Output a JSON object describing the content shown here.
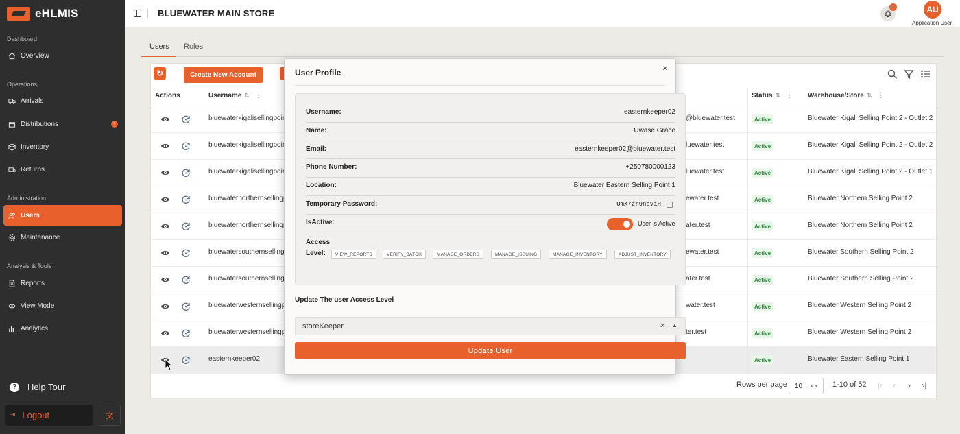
{
  "app": {
    "name": "eHLMIS"
  },
  "sidebar": {
    "sections": {
      "dashboard": "Dashboard",
      "operations": "Operations",
      "administration": "Administration",
      "analysis": "Analysis & Tools"
    },
    "items": [
      {
        "label": "Overview",
        "icon": "home-icon"
      },
      {
        "label": "Arrivals",
        "icon": "truck-icon"
      },
      {
        "label": "Distributions",
        "icon": "box-icon",
        "badge": "1"
      },
      {
        "label": "Inventory",
        "icon": "cube-icon"
      },
      {
        "label": "Returns",
        "icon": "return-icon"
      },
      {
        "label": "Users",
        "icon": "users-icon",
        "active": true
      },
      {
        "label": "Maintenance",
        "icon": "gear-icon"
      },
      {
        "label": "Reports",
        "icon": "file-icon"
      },
      {
        "label": "View Mode",
        "icon": "eye-icon"
      },
      {
        "label": "Analytics",
        "icon": "bar-chart-icon"
      }
    ],
    "help_tour": "Help Tour",
    "logout": "Logout"
  },
  "header": {
    "store_title": "BLUEWATER MAIN STORE",
    "notification_count": "1",
    "avatar_initials": "AU",
    "user_name": "Application User"
  },
  "tabs": [
    {
      "label": "Users",
      "active": true
    },
    {
      "label": "Roles",
      "active": false
    }
  ],
  "toolbar": {
    "create_label": "Create New Account"
  },
  "table": {
    "headers": {
      "actions": "Actions",
      "username": "Username",
      "status": "Status",
      "warehouse": "Warehouse/Store"
    },
    "rows": [
      {
        "username": "bluewaterkigalisellingpoint",
        "email": "@bluewater.test",
        "status": "Active",
        "warehouse": "Bluewater Kigali Selling Point 2 - Outlet 2"
      },
      {
        "username": "bluewaterkigalisellingpoint",
        "email": "luewater.test",
        "status": "Active",
        "warehouse": "Bluewater Kigali Selling Point 2 - Outlet 2"
      },
      {
        "username": "bluewaterkigalisellingpoint",
        "email": "luewater.test",
        "status": "Active",
        "warehouse": "Bluewater Kigali Selling Point 2 - Outlet 1"
      },
      {
        "username": "bluewaternorthernsellingp",
        "email": "ewater.test",
        "status": "Active",
        "warehouse": "Bluewater Northern Selling Point 2"
      },
      {
        "username": "bluewaternorthernsellingp",
        "email": "ater.test",
        "status": "Active",
        "warehouse": "Bluewater Northern Selling Point 2"
      },
      {
        "username": "bluewatersouthernsellingp",
        "email": "ewater.test",
        "status": "Active",
        "warehouse": "Bluewater Southern Selling Point 2"
      },
      {
        "username": "bluewatersouthernsellingp",
        "email": "ater.test",
        "status": "Active",
        "warehouse": "Bluewater Southern Selling Point 2"
      },
      {
        "username": "bluewaterwesternsellingpo",
        "email": "water.test",
        "status": "Active",
        "warehouse": "Bluewater Western Selling Point 2"
      },
      {
        "username": "bluewaterwesternsellingpo",
        "email": "ter.test",
        "status": "Active",
        "warehouse": "Bluewater Western Selling Point 2"
      },
      {
        "username": "easternkeeper02",
        "email": "",
        "status": "Active",
        "warehouse": "Bluewater Eastern Selling Point 1"
      }
    ]
  },
  "pagination": {
    "rows_per_page_label": "Rows per page",
    "rows_per_page": "10",
    "range": "1-10 of 52"
  },
  "modal": {
    "title": "User Profile",
    "fields": {
      "username_label": "Username:",
      "username": "easternkeeper02",
      "name_label": "Name:",
      "name": "Uwase Grace",
      "email_label": "Email:",
      "email": "easternkeeper02@bluewater.test",
      "phone_label": "Phone Number:",
      "phone": "+250780000123",
      "location_label": "Location:",
      "location": "Bluewater Eastern Selling Point 1",
      "temp_password_label": "Temporary Password:",
      "temp_password": "OmX7zr9nsViH",
      "is_active_label": "IsActive:",
      "is_active_text": "User is Active",
      "access_label_1": "Access",
      "access_label_2": "Level:"
    },
    "permissions": [
      "VIEW_REPORTS",
      "VERIFY_BATCH",
      "MANAGE_ORDERS",
      "MANAGE_ISSUING",
      "MANAGE_INVENTORY",
      "ADJUST_INVENTORY"
    ],
    "update_section_title": "Update The user Access Level",
    "selected_role": "storeKeeper",
    "update_button": "Update User"
  },
  "colors": {
    "accent": "#e8602c",
    "sidebar_bg": "#2e2e2e",
    "active_green": "#2f8a3c"
  }
}
